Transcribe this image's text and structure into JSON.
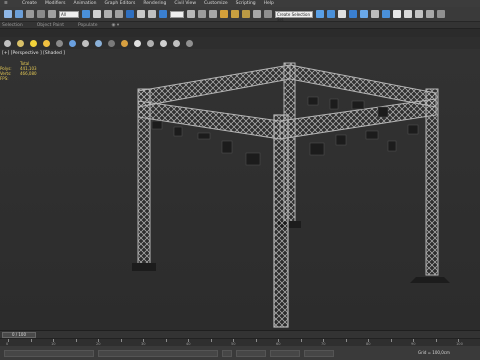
{
  "menu": [
    "≡",
    "Create",
    "Modifiers",
    "Animation",
    "Graph Editors",
    "Rendering",
    "Civil View",
    "Customize",
    "Scripting",
    "Help"
  ],
  "toolbar": {
    "selection_filter": "All",
    "selection_set": "Create Selection Set",
    "colors": [
      "#4a90d9",
      "#2f6fc0",
      "#5aa0e6",
      "#e05050",
      "#c8c8c8",
      "#5aa0e6",
      "#3a7fd0",
      "#d4a03a",
      "#4a90d9",
      "#e0e0e0",
      "#bdbdbd",
      "#3a7fd0",
      "#6aa8e8",
      "#4a90d9"
    ]
  },
  "ribbon_tabs": [
    "Selection",
    "Object Paint",
    "Populate",
    "◉ ▾"
  ],
  "light_toolbar": {
    "colors": [
      "#c0c0c0",
      "#d8c068",
      "#f2d23a",
      "#f0c040",
      "#8a8a8a",
      "#6aa0e0",
      "#c0c0c0",
      "#8ab0d8",
      "#7a7a7a",
      "#d8a040",
      "#e0e0e0",
      "#b0b0b0",
      "#d0d0d0",
      "#c0c0c0",
      "#909090"
    ]
  },
  "viewport": {
    "label": "[+] [Perspective ] [Shaded ]",
    "stats": {
      "header": "Total",
      "rows": [
        {
          "key": "Polys:",
          "value": "441,103"
        },
        {
          "key": "Verts:",
          "value": "466,080"
        }
      ],
      "extra": "FPS:"
    },
    "truss_color": "#b6b6b6",
    "truss_shadow": "#7e7e7e",
    "fixture_color": "#1c1c1c"
  },
  "timeline": {
    "frame_counter": "0 / 100",
    "ticks": [
      0,
      5,
      10,
      15,
      20,
      25,
      30,
      35,
      40,
      45,
      50,
      55,
      60,
      65,
      70,
      75,
      80,
      85,
      90,
      95,
      100
    ]
  },
  "status": {
    "grid": "Grid = 100,0cm"
  }
}
